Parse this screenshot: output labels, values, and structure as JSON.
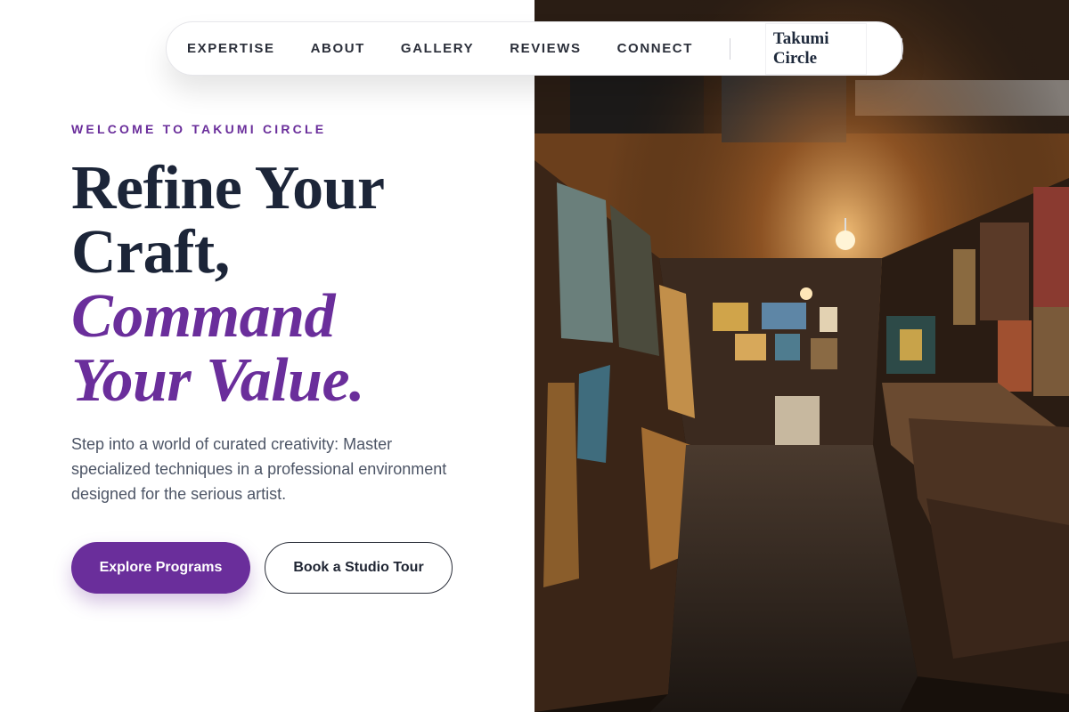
{
  "nav": {
    "links": [
      "EXPERTISE",
      "ABOUT",
      "GALLERY",
      "REVIEWS",
      "CONNECT"
    ],
    "brand": "Takumi Circle"
  },
  "hero": {
    "eyebrow": "WELCOME TO TAKUMI CIRCLE",
    "headline_line1": "Refine Your",
    "headline_line2": "Craft,",
    "headline_line3": "Command",
    "headline_line4": "Your Value.",
    "description": "Step into a world of curated creativity: Master specialized techniques in a professional environment designed for the serious artist.",
    "primary_cta": "Explore Programs",
    "secondary_cta": "Book a Studio Tour"
  },
  "image": {
    "alt": "Dimly lit art gallery corridor filled with framed paintings"
  },
  "colors": {
    "accent": "#6a2e9b",
    "heading": "#1c2538",
    "body": "#4d5566"
  }
}
